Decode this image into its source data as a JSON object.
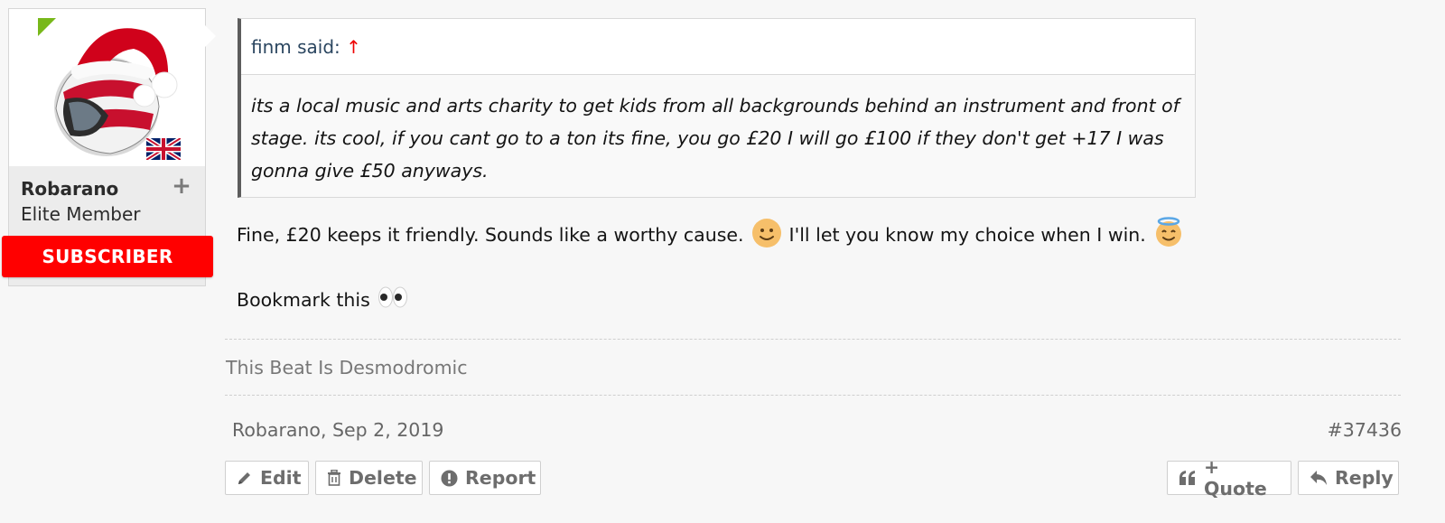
{
  "user": {
    "name": "Robarano",
    "title": "Elite Member",
    "badge": "SUBSCRIBER",
    "follow_symbol": "+",
    "avatar_icon": "santa-helmet-avatar",
    "flag_icon": "uk-flag-icon"
  },
  "quote": {
    "author_label": "finm said:",
    "jump_symbol": "↑",
    "text": "its a local music and arts charity to get kids from all backgrounds behind an instrument and front of stage. its cool, if you cant go to a ton its fine, you go £20 I will go £100 if they don't get +17 I was gonna give £50 anyways."
  },
  "message": {
    "line1_part1": "Fine, £20 keeps it friendly. Sounds like a worthy cause.",
    "line1_part2": "I'll let you know my choice when I win.",
    "line2": "Bookmark this",
    "emojis": [
      "smile-emoji",
      "angel-emoji",
      "eyes-emoji"
    ]
  },
  "signature": "This Beat Is Desmodromic",
  "meta": {
    "author_date": "Robarano, Sep 2, 2019",
    "post_number": "#37436"
  },
  "actions": {
    "edit": "Edit",
    "delete": "Delete",
    "report": "Report",
    "quote": "+ Quote",
    "reply": "Reply"
  },
  "colors": {
    "badge": "#ff0000",
    "online": "#78b81a",
    "quote_author": "#2b4660",
    "page_bg": "#f7f7f7"
  }
}
